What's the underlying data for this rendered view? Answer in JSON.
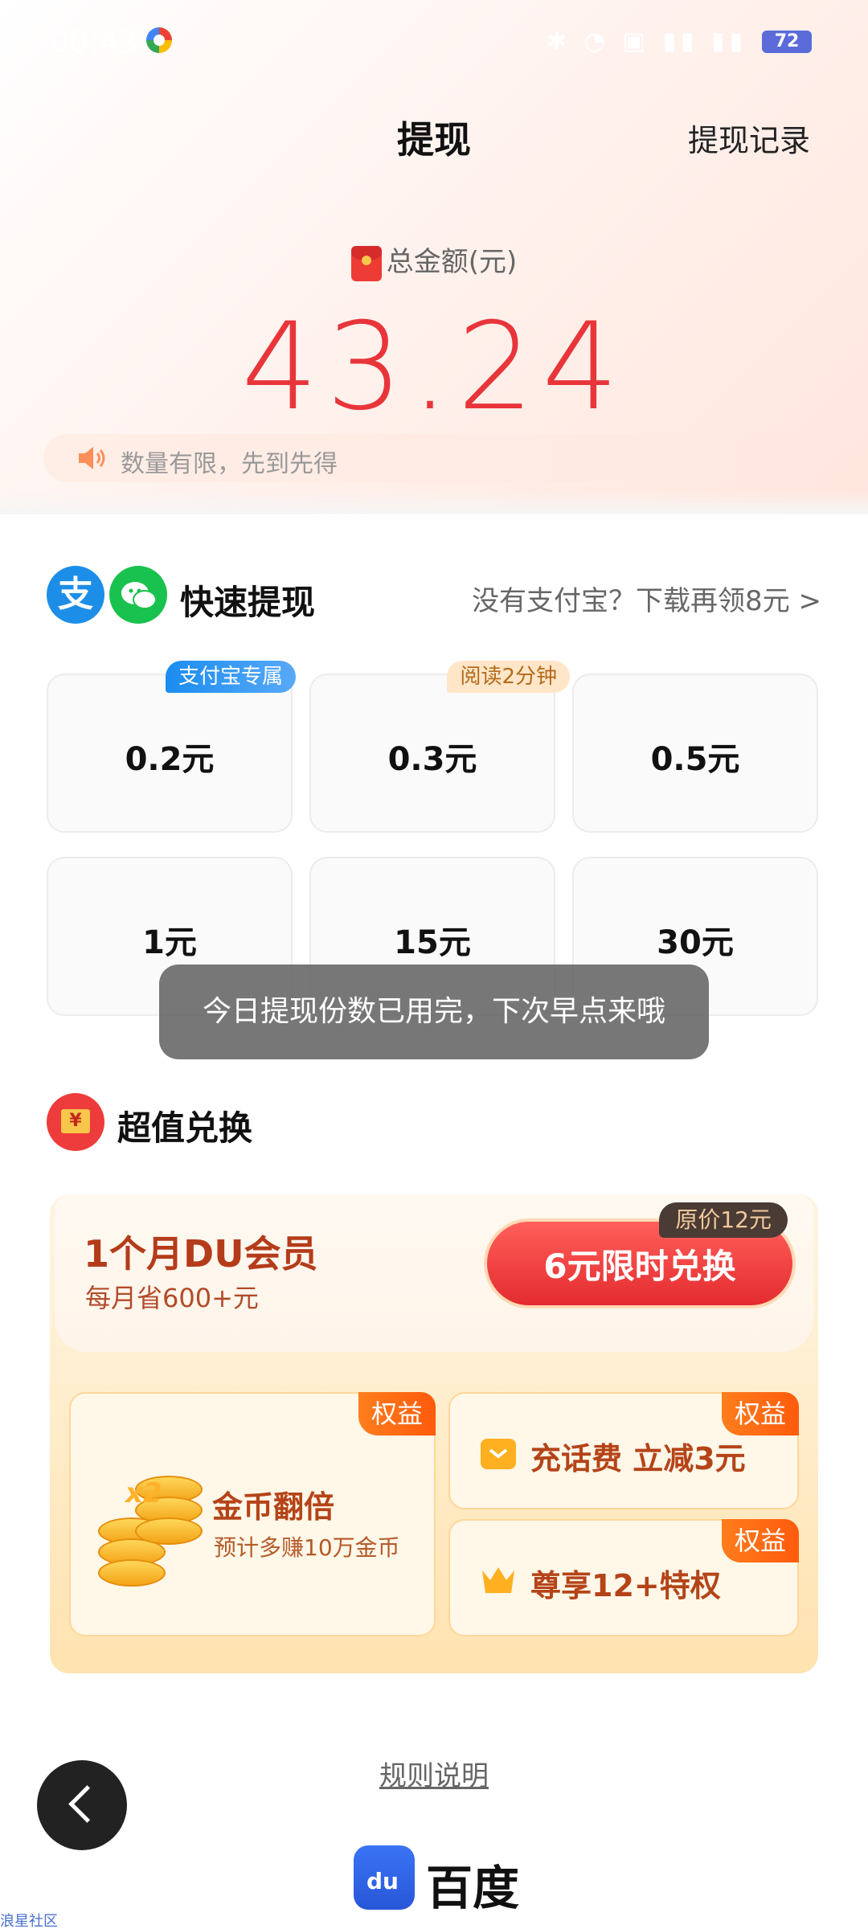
{
  "status_bar": {
    "time": "00:43",
    "battery": "72"
  },
  "header": {
    "title": "提现",
    "record_link": "提现记录"
  },
  "balance": {
    "label": "总金额(元)",
    "amount": "43.24"
  },
  "notice": {
    "text": "数量有限，先到先得"
  },
  "quick_withdraw": {
    "title": "快速提现",
    "alipay_glyph": "支",
    "download_prompt": "没有支付宝？下载再领8元 >",
    "options": [
      {
        "value": "0.2元",
        "badge": "支付宝专属"
      },
      {
        "value": "0.3元",
        "badge": "阅读2分钟"
      },
      {
        "value": "0.5元"
      },
      {
        "value": "1元"
      },
      {
        "value": "15元"
      },
      {
        "value": "30元"
      }
    ]
  },
  "toast": {
    "text": "今日提现份数已用完，下次早点来哦"
  },
  "exchange": {
    "title": "超值兑换",
    "membership": {
      "title": "1个月DU会员",
      "subtitle": "每月省600+元",
      "button": "6元限时兑换",
      "original_price": "原价12元"
    },
    "perks": [
      {
        "tag": "权益",
        "title": "金币翻倍",
        "subtitle": "预计多赚10万金币",
        "badge": "x2"
      },
      {
        "tag": "权益",
        "title": "充话费 立减3元"
      },
      {
        "tag": "权益",
        "title": "尊享12+特权"
      }
    ]
  },
  "footer": {
    "rules_link": "规则说明",
    "brand": "百度",
    "corner_label": "浪星社区"
  }
}
